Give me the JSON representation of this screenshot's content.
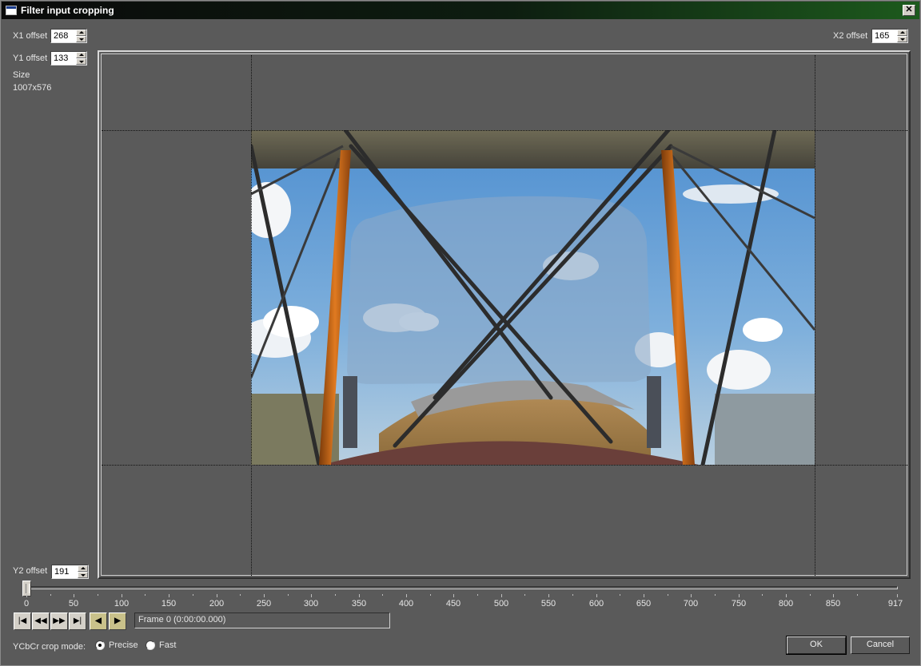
{
  "window": {
    "title": "Filter input cropping"
  },
  "offsets": {
    "x1_label": "X1 offset",
    "x1_value": "268",
    "y1_label": "Y1 offset",
    "y1_value": "133",
    "x2_label": "X2 offset",
    "x2_value": "165",
    "y2_label": "Y2 offset",
    "y2_value": "191",
    "size_label": "Size",
    "size_value": "1007x576"
  },
  "timeline": {
    "ticks": [
      "0",
      "50",
      "100",
      "150",
      "200",
      "250",
      "300",
      "350",
      "400",
      "450",
      "500",
      "550",
      "600",
      "650",
      "700",
      "750",
      "800",
      "850",
      "917"
    ],
    "position": 0,
    "frame_text": "Frame 0 (0:00:00.000)"
  },
  "transport": {
    "buttons": [
      "|◀",
      "◀◀",
      "▶▶",
      "▶|",
      "◀",
      "▶"
    ],
    "icons": [
      "go-start-icon",
      "prev-keyframe-icon",
      "next-keyframe-icon",
      "go-end-icon",
      "prev-key-icon",
      "next-key-icon"
    ]
  },
  "crop_mode": {
    "label": "YCbCr crop mode:",
    "options": [
      "Precise",
      "Fast"
    ],
    "selected": "Precise"
  },
  "buttons": {
    "ok": "OK",
    "cancel": "Cancel"
  },
  "colors": {
    "titlebar_start": "#0a0a0a",
    "titlebar_end": "#1d5a1d",
    "background": "#5a5a5a"
  }
}
